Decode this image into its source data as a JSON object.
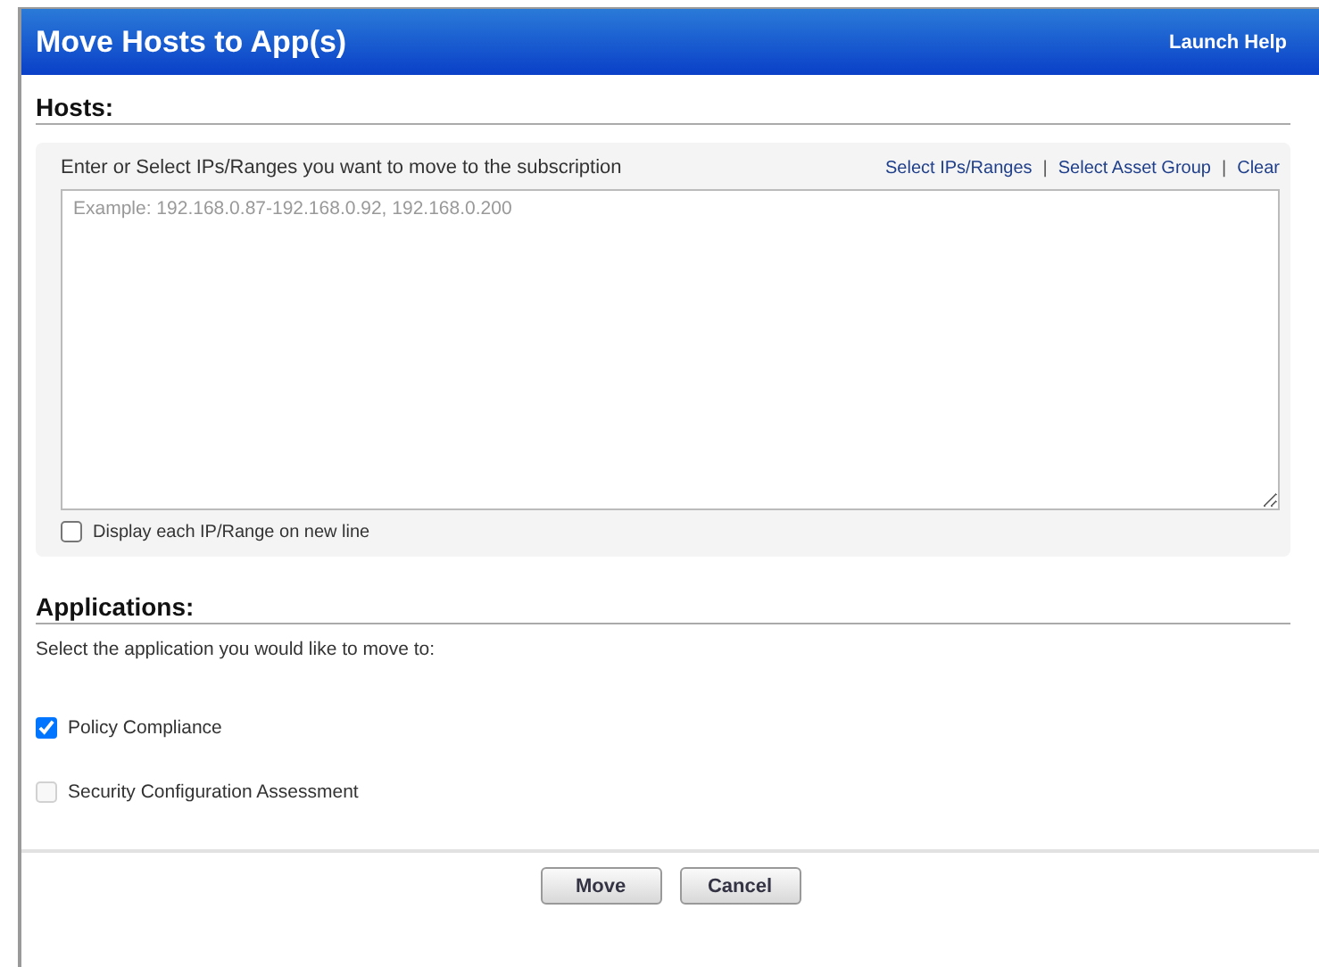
{
  "window": {
    "title": "Move Hosts to App(s)",
    "help_link": "Launch Help"
  },
  "hosts": {
    "heading": "Hosts:",
    "prompt": "Enter or Select IPs/Ranges you want to move to the subscription",
    "links": [
      {
        "label": "Select IPs/Ranges"
      },
      {
        "label": "Select Asset Group"
      },
      {
        "label": "Clear"
      }
    ],
    "separator": "|",
    "field": {
      "placeholder": "Example: 192.168.0.87-192.168.0.92, 192.168.0.200"
    },
    "option": {
      "label": "Display each IP/Range on new line",
      "checked": false
    }
  },
  "applications": {
    "heading": "Applications:",
    "prompt": "Select the application you would like to move to:",
    "items": [
      {
        "label": "Policy Compliance",
        "checked": true,
        "disabled": false
      },
      {
        "label": "Security Configuration Assessment",
        "checked": false,
        "disabled": true
      }
    ]
  },
  "buttons": [
    {
      "label": "Move"
    },
    {
      "label": "Cancel"
    }
  ]
}
